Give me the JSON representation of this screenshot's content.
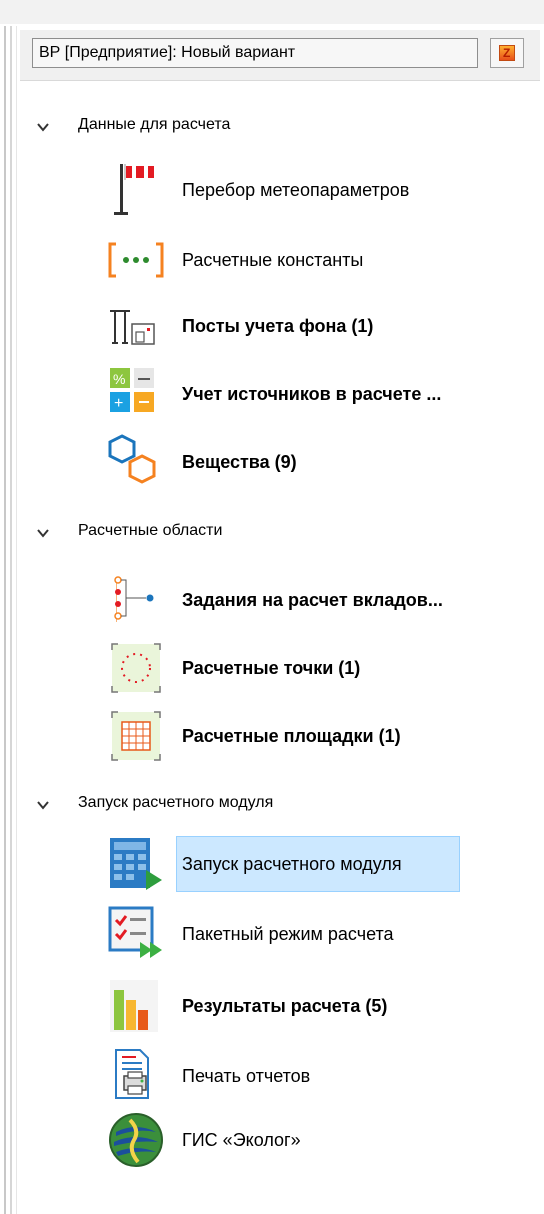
{
  "header": {
    "variant_text": "ВР [Предприятие]: Новый вариант",
    "refresh_icon": "refresh-icon",
    "refresh_glyph": "Z"
  },
  "groups": [
    {
      "label": "Данные для расчета",
      "items": [
        {
          "label": "Перебор метеопараметров",
          "bold": false,
          "icon": "weather-vane-icon"
        },
        {
          "label": "Расчетные константы",
          "bold": false,
          "icon": "constants-icon"
        },
        {
          "label": "Посты учета фона (1)",
          "bold": true,
          "icon": "background-post-icon"
        },
        {
          "label": "Учет источников в расчете ...",
          "bold": true,
          "icon": "sources-accounting-icon"
        },
        {
          "label": "Вещества (9)",
          "bold": true,
          "icon": "substances-icon"
        }
      ]
    },
    {
      "label": "Расчетные области",
      "items": [
        {
          "label": "Задания на расчет вкладов...",
          "bold": true,
          "icon": "contribution-tasks-icon"
        },
        {
          "label": "Расчетные точки (1)",
          "bold": true,
          "icon": "calculation-points-icon"
        },
        {
          "label": "Расчетные площадки (1)",
          "bold": true,
          "icon": "calculation-areas-icon"
        }
      ]
    },
    {
      "label": "Запуск расчетного модуля",
      "items": [
        {
          "label": "Запуск расчетного модуля",
          "bold": false,
          "icon": "run-module-icon",
          "selected": true
        },
        {
          "label": "Пакетный режим расчета",
          "bold": false,
          "icon": "batch-mode-icon"
        },
        {
          "label": "Результаты расчета (5)",
          "bold": true,
          "icon": "results-chart-icon"
        },
        {
          "label": "Печать отчетов",
          "bold": false,
          "icon": "print-reports-icon"
        },
        {
          "label": "ГИС «Эколог»",
          "bold": false,
          "icon": "gis-ecolog-icon"
        }
      ]
    }
  ],
  "colors": {
    "selection_bg": "#cce8ff",
    "selection_border": "#99d1ff",
    "accent_orange": "#f58220",
    "accent_red": "#e31b23",
    "accent_blue": "#1b75bc"
  }
}
